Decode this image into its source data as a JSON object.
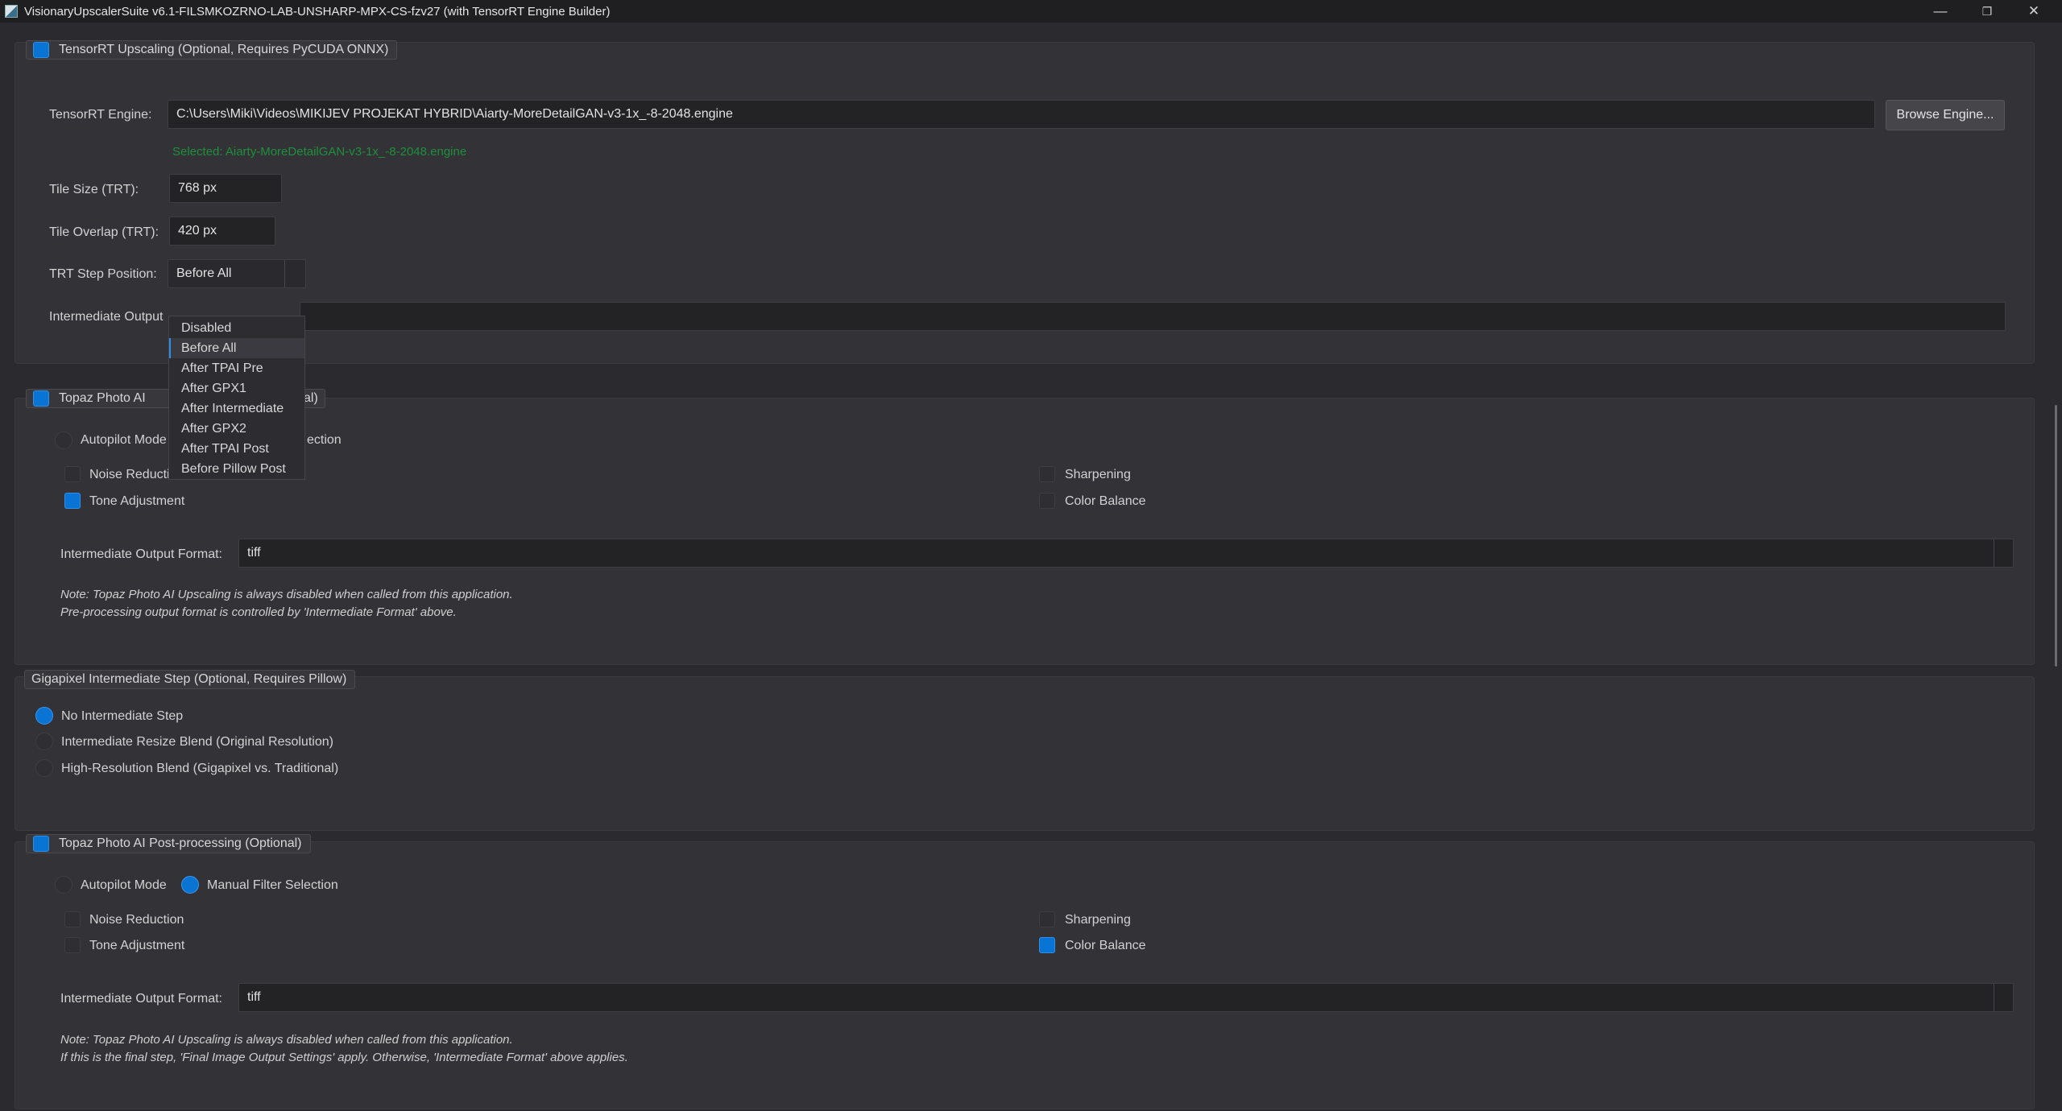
{
  "window": {
    "title": "VisionaryUpscalerSuite v6.1-FILSMKOZRNO-LAB-UNSHARP-MPX-CS-fzv27 (with TensorRT Engine Builder)",
    "minimize": "—",
    "maximize": "❐",
    "close": "✕"
  },
  "tensorrt": {
    "title": "TensorRT Upscaling (Optional, Requires PyCUDA  ONNX)",
    "enabled": true,
    "engine_label": "TensorRT Engine:",
    "engine_path": "C:\\Users\\Miki\\Videos\\MIKIJEV PROJEKAT HYBRID\\Aiarty-MoreDetailGAN-v3-1x_-8-2048.engine",
    "browse_label": "Browse Engine...",
    "selected_text": "Selected: Aiarty-MoreDetailGAN-v3-1x_-8-2048.engine",
    "tile_size_label": "Tile Size (TRT):",
    "tile_size_value": "768 px",
    "tile_overlap_label": "Tile Overlap (TRT):",
    "tile_overlap_value": "420 px",
    "step_position_label": "TRT Step Position:",
    "step_position_value": "Before All",
    "intermediate_output_label": "Intermediate Output",
    "step_position_options": [
      "Disabled",
      "Before All",
      "After TPAI Pre",
      "After GPX1",
      "After Intermediate",
      "After GPX2",
      "After TPAI Post",
      "Before Pillow Post"
    ],
    "selected_option_index": 1
  },
  "topaz_pre": {
    "title_left": "Topaz Photo AI",
    "title_right": "al)",
    "enabled": true,
    "autopilot_label": "Autopilot Mode",
    "manual_label_partial": "ection",
    "noise_reduction_label": "Noise Reduction",
    "noise_reduction": false,
    "tone_adjustment_label": "Tone Adjustment",
    "tone_adjustment": true,
    "sharpening_label": "Sharpening",
    "sharpening": false,
    "color_balance_label": "Color Balance",
    "color_balance": false,
    "format_label": "Intermediate Output Format:",
    "format_value": "tiff",
    "note_line1": "Note: Topaz Photo AI Upscaling is always disabled when called from this application.",
    "note_line2": "Pre-processing output format is controlled by 'Intermediate Format' above."
  },
  "gigapixel": {
    "title": "Gigapixel Intermediate Step (Optional, Requires Pillow)",
    "options": [
      "No Intermediate Step",
      "Intermediate Resize  Blend (Original Resolution)",
      "High-Resolution Blend (Gigapixel vs. Traditional)"
    ],
    "selected_index": 0
  },
  "topaz_post": {
    "title": "Topaz Photo AI Post-processing (Optional)",
    "enabled": true,
    "autopilot_label": "Autopilot Mode",
    "manual_label": "Manual Filter Selection",
    "mode": "manual",
    "noise_reduction_label": "Noise Reduction",
    "noise_reduction": false,
    "tone_adjustment_label": "Tone Adjustment",
    "tone_adjustment": false,
    "sharpening_label": "Sharpening",
    "sharpening": false,
    "color_balance_label": "Color Balance",
    "color_balance": true,
    "format_label": "Intermediate Output Format:",
    "format_value": "tiff",
    "note_line1": "Note: Topaz Photo AI Upscaling is always disabled when called from this application.",
    "note_line2": "If this is the final step, 'Final Image Output Settings' apply. Otherwise, 'Intermediate Format' above applies."
  },
  "colors": {
    "accent": "#0a74d4",
    "background": "#2b2b2f",
    "panel": "#333337",
    "selected_text": "#1e8f3a"
  }
}
